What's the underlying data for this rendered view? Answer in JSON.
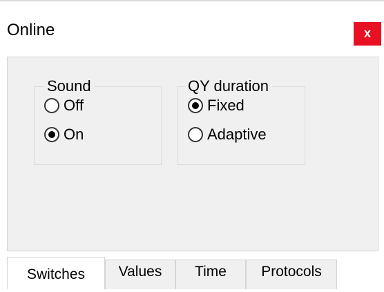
{
  "window": {
    "title": "Online",
    "close_label": "x",
    "close_color": "#e81123"
  },
  "sound_group": {
    "label": "Sound",
    "options": [
      {
        "label": "Off",
        "checked": false
      },
      {
        "label": "On",
        "checked": true
      }
    ]
  },
  "qy_group": {
    "label": "QY duration",
    "options": [
      {
        "label": "Fixed",
        "checked": true
      },
      {
        "label": "Adaptive",
        "checked": false
      }
    ]
  },
  "tabs": [
    {
      "label": "Switches",
      "active": true
    },
    {
      "label": "Values",
      "active": false
    },
    {
      "label": "Time",
      "active": false
    },
    {
      "label": "Protocols",
      "active": false
    }
  ]
}
